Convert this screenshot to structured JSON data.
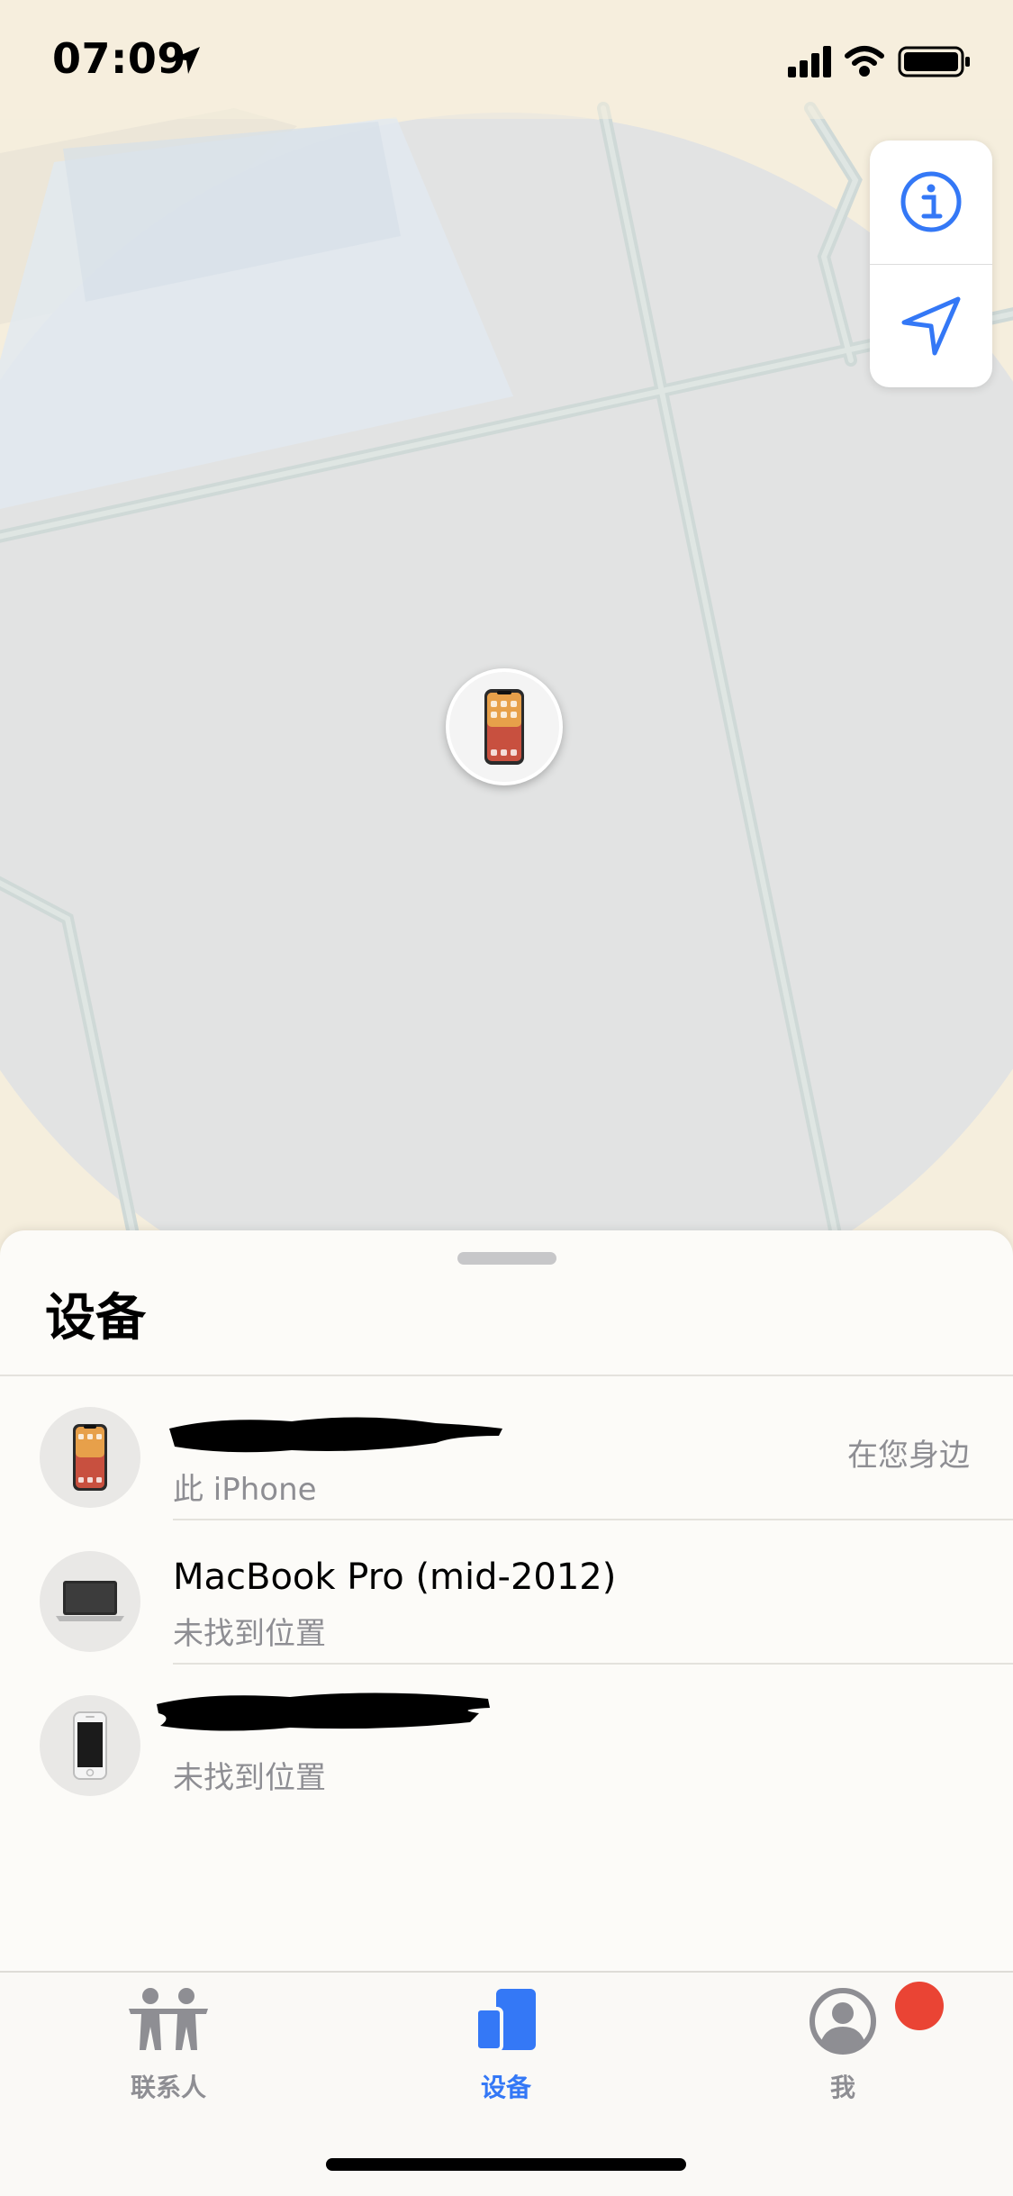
{
  "status_bar": {
    "time": "07:09",
    "location_icon": "location-arrow-icon",
    "signal_icon": "cellular-signal-icon",
    "wifi_icon": "wifi-icon",
    "battery_icon": "battery-icon"
  },
  "map_controls": {
    "info_icon": "info-icon",
    "locate_icon": "location-arrow-icon"
  },
  "sheet": {
    "title": "设备",
    "devices": [
      {
        "name": "",
        "subtitle": "此 iPhone",
        "status": "在您身边",
        "icon": "iphone-color-icon",
        "name_redacted": true
      },
      {
        "name": "MacBook Pro (mid-2012)",
        "subtitle": "未找到位置",
        "status": "",
        "icon": "macbook-icon",
        "name_redacted": false
      },
      {
        "name": "",
        "subtitle": "未找到位置",
        "status": "",
        "icon": "iphone-white-icon",
        "name_redacted": true
      }
    ]
  },
  "tab_bar": {
    "tabs": [
      {
        "label": "联系人",
        "icon": "people-icon",
        "active": false
      },
      {
        "label": "设备",
        "icon": "devices-icon",
        "active": true
      },
      {
        "label": "我",
        "icon": "person-circle-icon",
        "active": false
      }
    ]
  },
  "colors": {
    "accent": "#3478f6",
    "badge": "#ea4434",
    "secondary_text": "#8e8e93"
  }
}
